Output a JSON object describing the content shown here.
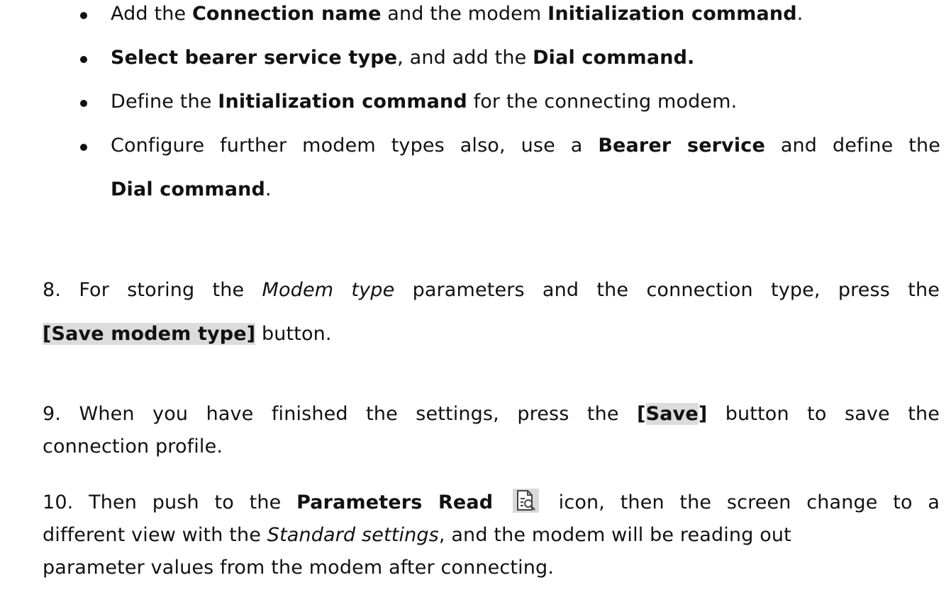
{
  "bullets": [
    {
      "parts": [
        "Add the ",
        "Connection name",
        " and the modem ",
        "Initialization command",
        "."
      ]
    },
    {
      "parts": [
        "Select bearer service type",
        ", and add the ",
        "Dial command."
      ]
    },
    {
      "parts": [
        "Define the ",
        "Initialization command",
        " for the connecting modem."
      ]
    },
    {
      "line1": [
        "Configure further modem types also, use a ",
        "Bearer service",
        " and define the"
      ],
      "line2": [
        "Dial command",
        "."
      ]
    }
  ],
  "step8": {
    "number": "8.",
    "line1": [
      "For storing the ",
      "Modem type",
      " parameters and the connection type, press the"
    ],
    "line2": [
      "[Save modem type]",
      " button."
    ]
  },
  "step9": {
    "number": "9.",
    "line1": [
      "When you have finished the settings, press the ",
      "[",
      "Save",
      "]",
      " button to save the"
    ],
    "line2": "connection profile."
  },
  "step10": {
    "number": "10.",
    "line1": [
      "Then push to the ",
      "Parameters Read",
      "icon, then the screen change to a"
    ],
    "line2": [
      "different view with the ",
      "Standard settings",
      ", and the modem will be reading out"
    ],
    "line3": "parameter values from the modem after connecting.",
    "icon": "parameters-read-icon"
  },
  "colors": {
    "text": "#111111",
    "button_highlight": "#dcdcdc",
    "icon_background": "#d9d9d9"
  }
}
